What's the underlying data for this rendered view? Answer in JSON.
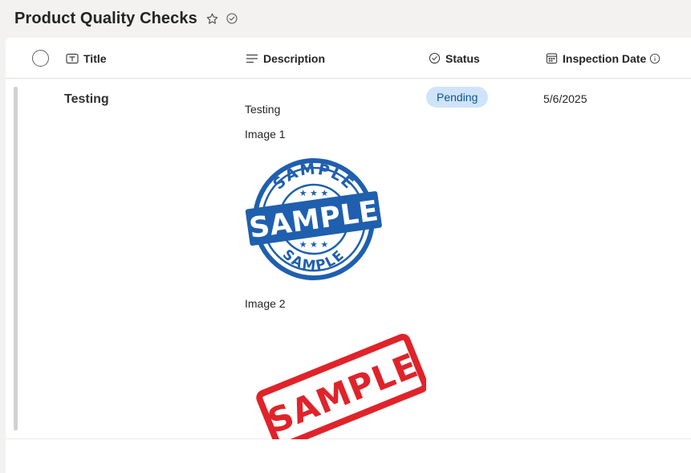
{
  "header": {
    "title": "Product Quality Checks",
    "favorite_icon": "star-icon",
    "status_icon": "check-circle-icon"
  },
  "columns": [
    {
      "label": "Title",
      "icon": "text-field-icon"
    },
    {
      "label": "Description",
      "icon": "multiline-text-icon"
    },
    {
      "label": "Status",
      "icon": "choice-check-icon"
    },
    {
      "label": "Inspection Date",
      "icon": "calendar-icon",
      "info_icon": "info-icon"
    }
  ],
  "rows": [
    {
      "title": "Testing",
      "description": {
        "line1": "Testing",
        "image1_label": "Image 1",
        "image1_stamp_text": "SAMPLE",
        "image2_label": "Image 2",
        "image2_stamp_text": "SAMPLE"
      },
      "status": "Pending",
      "inspection_date": "5/6/2025"
    }
  ],
  "colors": {
    "status_bg": "#cfe4fa",
    "status_fg": "#0f548c",
    "stamp_blue": "#1f5fae",
    "stamp_red": "#e0232a"
  }
}
